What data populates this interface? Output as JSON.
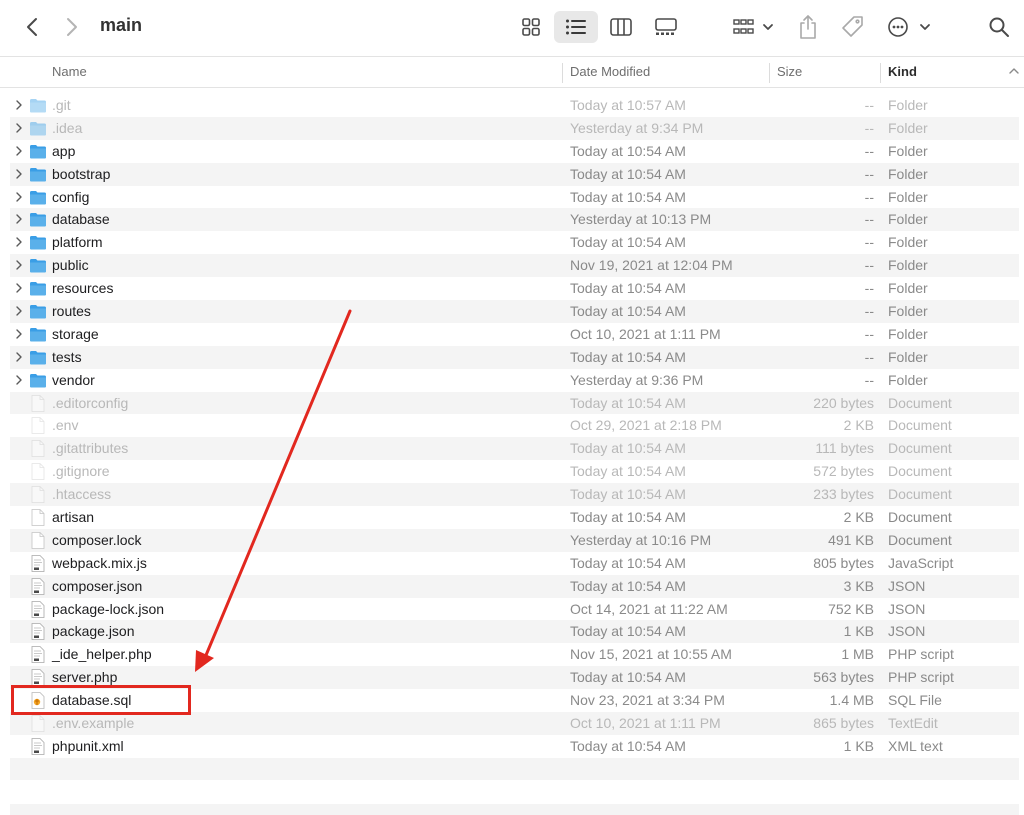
{
  "window": {
    "title": "main"
  },
  "toolbar": {
    "back_icon": "chevron-left-icon",
    "forward_icon": "chevron-right-icon",
    "views": [
      "icon-view-icon",
      "list-view-icon",
      "column-view-icon",
      "gallery-view-icon"
    ],
    "active_view": "list-view-icon",
    "group_icon": "group-icon",
    "share_icon": "share-icon",
    "tag_icon": "tag-icon",
    "more_icon": "ellipsis-icon",
    "search_icon": "search-icon"
  },
  "columns": {
    "name": "Name",
    "date": "Date Modified",
    "size": "Size",
    "kind": "Kind"
  },
  "files": [
    {
      "name": ".git",
      "date": "Today at 10:57 AM",
      "size": "--",
      "kind": "Folder",
      "type": "folder",
      "dim": true
    },
    {
      "name": ".idea",
      "date": "Yesterday at 9:34 PM",
      "size": "--",
      "kind": "Folder",
      "type": "folder",
      "dim": true
    },
    {
      "name": "app",
      "date": "Today at 10:54 AM",
      "size": "--",
      "kind": "Folder",
      "type": "folder",
      "dim": false
    },
    {
      "name": "bootstrap",
      "date": "Today at 10:54 AM",
      "size": "--",
      "kind": "Folder",
      "type": "folder",
      "dim": false
    },
    {
      "name": "config",
      "date": "Today at 10:54 AM",
      "size": "--",
      "kind": "Folder",
      "type": "folder",
      "dim": false
    },
    {
      "name": "database",
      "date": "Yesterday at 10:13 PM",
      "size": "--",
      "kind": "Folder",
      "type": "folder",
      "dim": false
    },
    {
      "name": "platform",
      "date": "Today at 10:54 AM",
      "size": "--",
      "kind": "Folder",
      "type": "folder",
      "dim": false
    },
    {
      "name": "public",
      "date": "Nov 19, 2021 at 12:04 PM",
      "size": "--",
      "kind": "Folder",
      "type": "folder",
      "dim": false
    },
    {
      "name": "resources",
      "date": "Today at 10:54 AM",
      "size": "--",
      "kind": "Folder",
      "type": "folder",
      "dim": false
    },
    {
      "name": "routes",
      "date": "Today at 10:54 AM",
      "size": "--",
      "kind": "Folder",
      "type": "folder",
      "dim": false
    },
    {
      "name": "storage",
      "date": "Oct 10, 2021 at 1:11 PM",
      "size": "--",
      "kind": "Folder",
      "type": "folder",
      "dim": false
    },
    {
      "name": "tests",
      "date": "Today at 10:54 AM",
      "size": "--",
      "kind": "Folder",
      "type": "folder",
      "dim": false
    },
    {
      "name": "vendor",
      "date": "Yesterday at 9:36 PM",
      "size": "--",
      "kind": "Folder",
      "type": "folder",
      "dim": false
    },
    {
      "name": ".editorconfig",
      "date": "Today at 10:54 AM",
      "size": "220 bytes",
      "kind": "Document",
      "type": "doc",
      "dim": true
    },
    {
      "name": ".env",
      "date": "Oct 29, 2021 at 2:18 PM",
      "size": "2 KB",
      "kind": "Document",
      "type": "doc",
      "dim": true
    },
    {
      "name": ".gitattributes",
      "date": "Today at 10:54 AM",
      "size": "111 bytes",
      "kind": "Document",
      "type": "doc",
      "dim": true
    },
    {
      "name": ".gitignore",
      "date": "Today at 10:54 AM",
      "size": "572 bytes",
      "kind": "Document",
      "type": "doc",
      "dim": true
    },
    {
      "name": ".htaccess",
      "date": "Today at 10:54 AM",
      "size": "233 bytes",
      "kind": "Document",
      "type": "doc",
      "dim": true
    },
    {
      "name": "artisan",
      "date": "Today at 10:54 AM",
      "size": "2 KB",
      "kind": "Document",
      "type": "doc",
      "dim": false
    },
    {
      "name": "composer.lock",
      "date": "Yesterday at 10:16 PM",
      "size": "491 KB",
      "kind": "Document",
      "type": "doc",
      "dim": false
    },
    {
      "name": "webpack.mix.js",
      "date": "Today at 10:54 AM",
      "size": "805 bytes",
      "kind": "JavaScript",
      "type": "code",
      "dim": false
    },
    {
      "name": "composer.json",
      "date": "Today at 10:54 AM",
      "size": "3 KB",
      "kind": "JSON",
      "type": "code",
      "dim": false
    },
    {
      "name": "package-lock.json",
      "date": "Oct 14, 2021 at 11:22 AM",
      "size": "752 KB",
      "kind": "JSON",
      "type": "code",
      "dim": false
    },
    {
      "name": "package.json",
      "date": "Today at 10:54 AM",
      "size": "1 KB",
      "kind": "JSON",
      "type": "code",
      "dim": false
    },
    {
      "name": "_ide_helper.php",
      "date": "Nov 15, 2021 at 10:55 AM",
      "size": "1 MB",
      "kind": "PHP script",
      "type": "code",
      "dim": false
    },
    {
      "name": "server.php",
      "date": "Today at 10:54 AM",
      "size": "563 bytes",
      "kind": "PHP script",
      "type": "code",
      "dim": false
    },
    {
      "name": "database.sql",
      "date": "Nov 23, 2021 at 3:34 PM",
      "size": "1.4 MB",
      "kind": "SQL File",
      "type": "sql",
      "dim": false
    },
    {
      "name": ".env.example",
      "date": "Oct 10, 2021 at 1:11 PM",
      "size": "865 bytes",
      "kind": "TextEdit",
      "type": "doc",
      "dim": true
    },
    {
      "name": "phpunit.xml",
      "date": "Today at 10:54 AM",
      "size": "1 KB",
      "kind": "XML text",
      "type": "code",
      "dim": false
    }
  ],
  "colors": {
    "folder": "#5ab0ea",
    "highlight": "#e2281f",
    "row_alt": "#f4f4f4"
  }
}
